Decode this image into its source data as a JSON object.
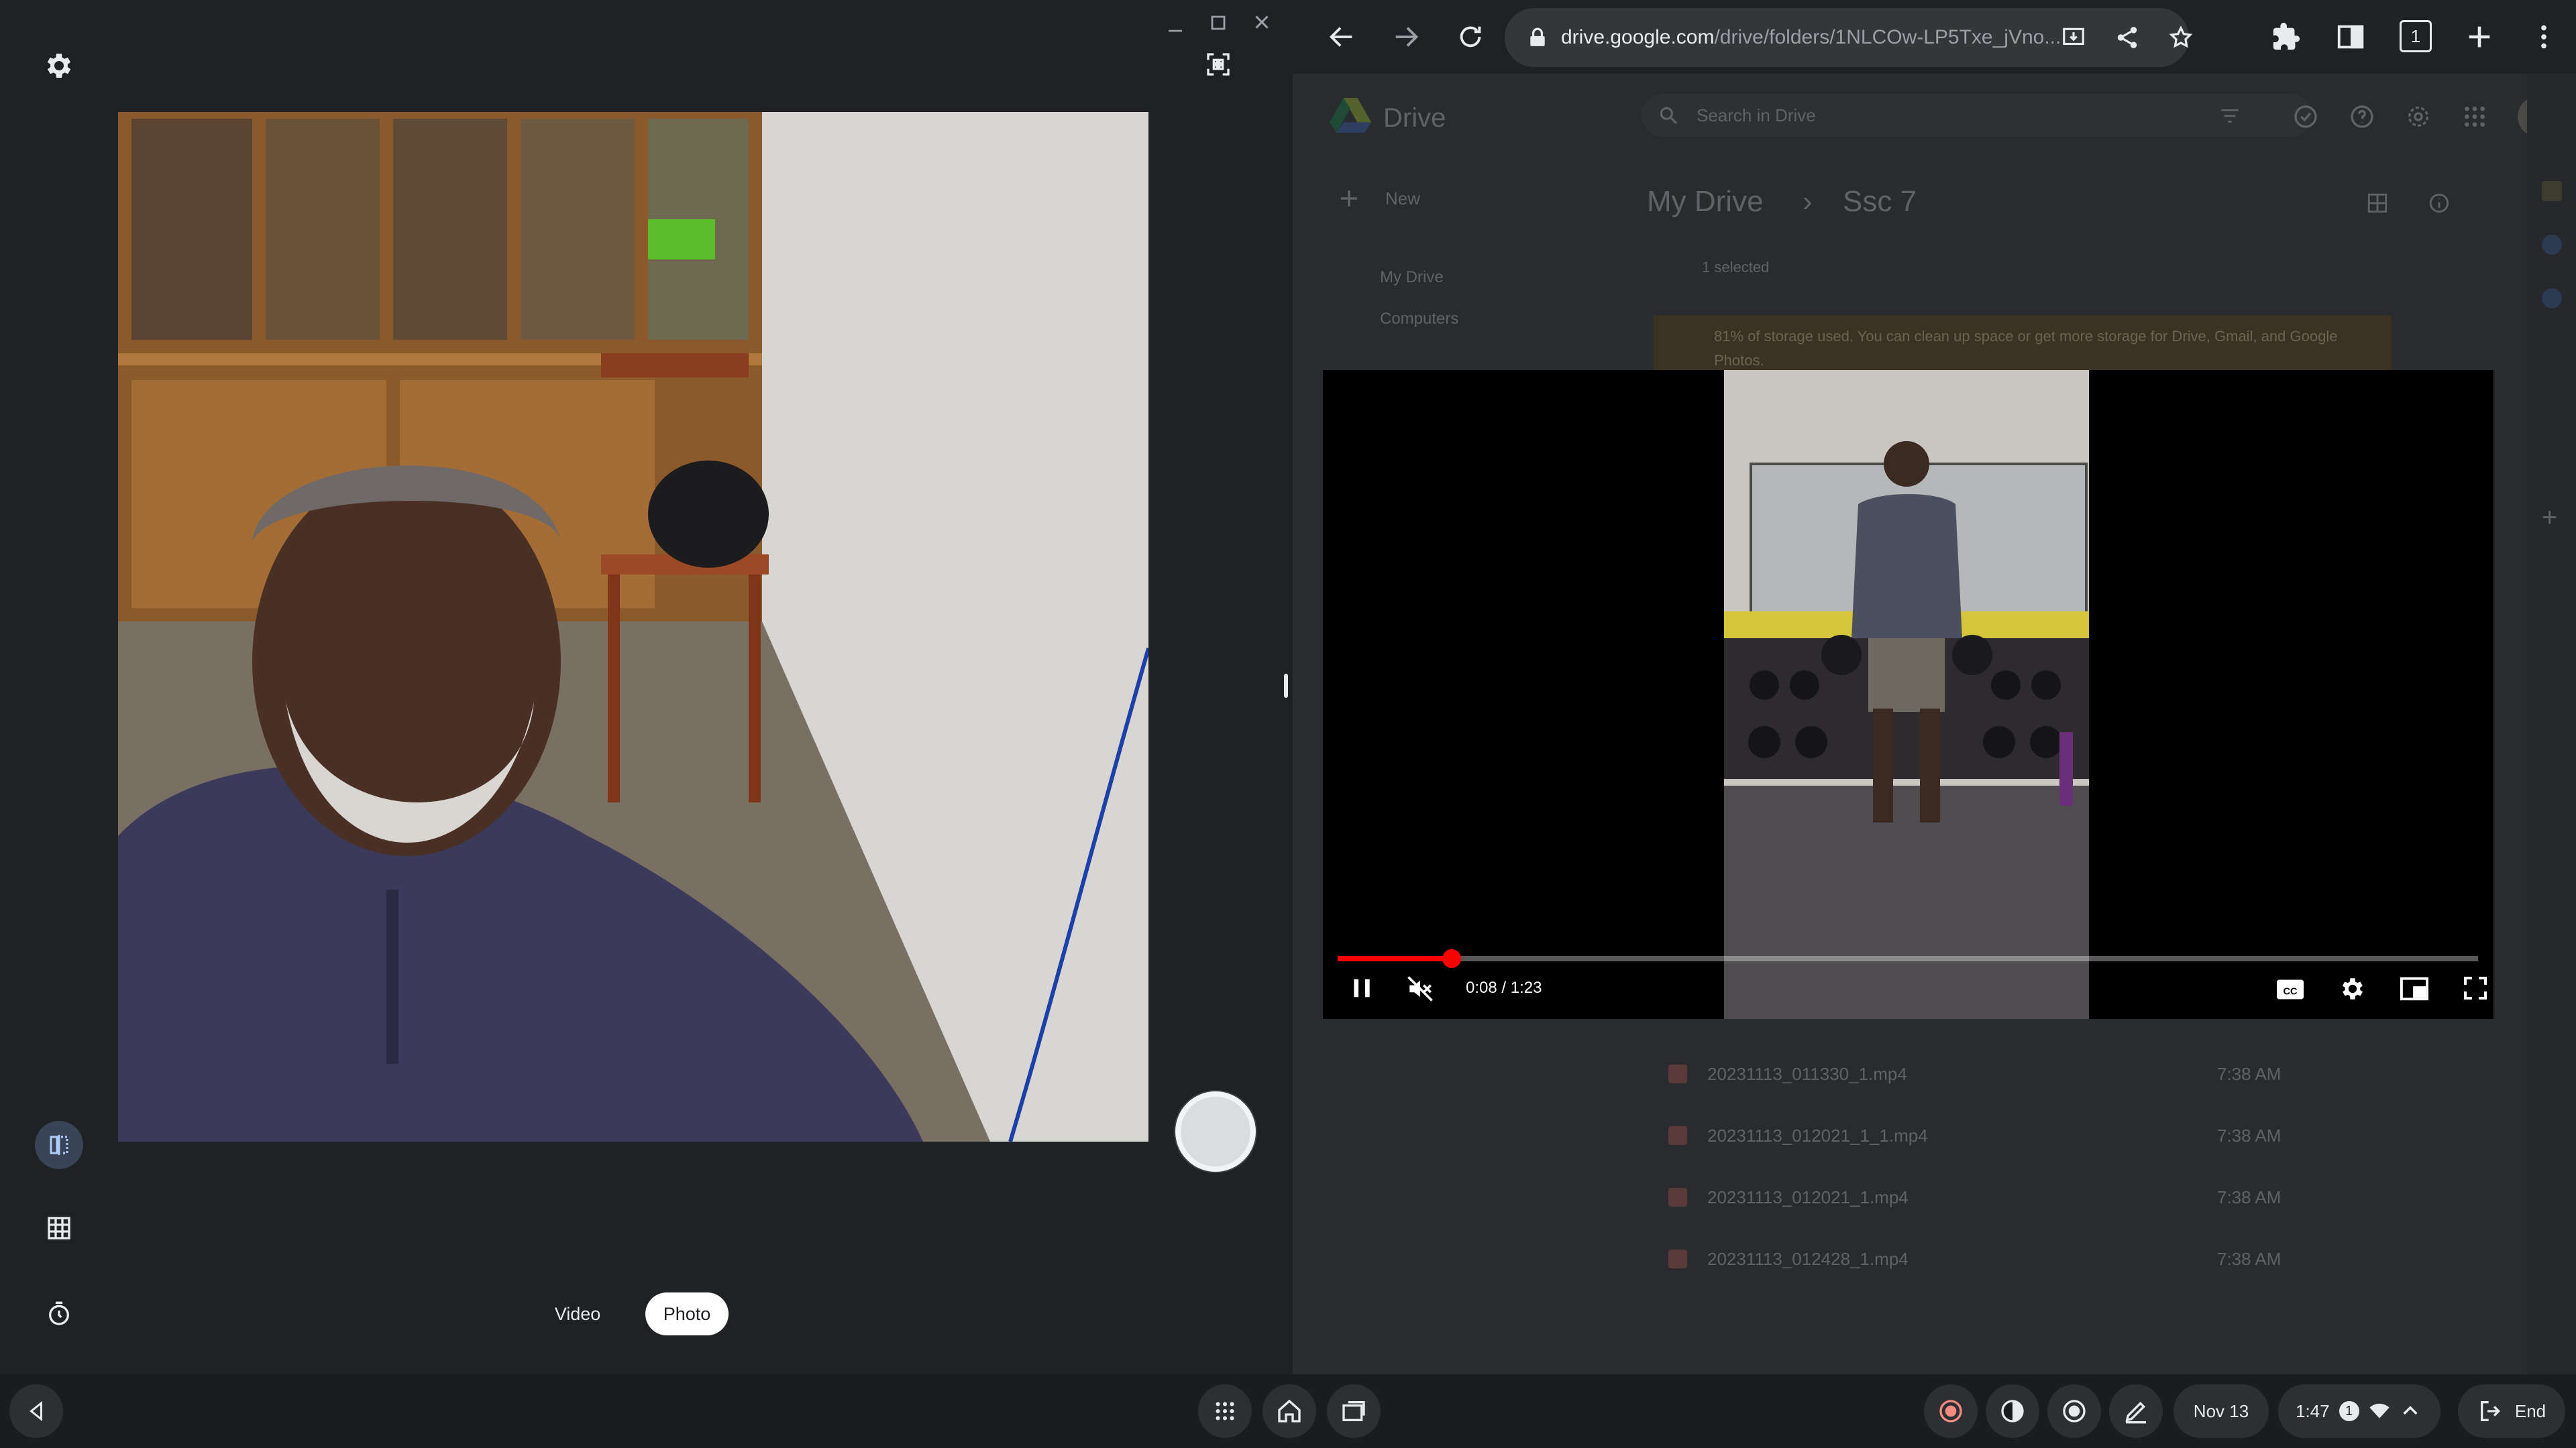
{
  "camera": {
    "modes": {
      "video": "Video",
      "photo": "Photo"
    },
    "selected_mode": "photo"
  },
  "browser": {
    "url_host": "drive.google.com",
    "url_path": "/drive/folders/1NLCOw-LP5Txe_jVno...",
    "tab_count": "1"
  },
  "drive": {
    "logo_text": "Drive",
    "search_placeholder": "Search in Drive",
    "new_button": "New",
    "nav": [
      "My Drive",
      "Computers"
    ],
    "breadcrumb": [
      "My Drive",
      "Ssc 7"
    ],
    "selection": "1 selected",
    "storage_banner": "81% of storage used. You can clean up space or get more storage for Drive, Gmail, and Google Photos.",
    "files": [
      {
        "name": "20231113_011330_1.mp4",
        "time": "7:38 AM"
      },
      {
        "name": "20231113_012021_1_1.mp4",
        "time": "7:38 AM"
      },
      {
        "name": "20231113_012021_1.mp4",
        "time": "7:38 AM"
      },
      {
        "name": "20231113_012428_1.mp4",
        "time": "7:38 AM"
      }
    ]
  },
  "video_player": {
    "time_display": "0:08 / 1:23",
    "progress": 0.1,
    "muted": true,
    "accent_color": "#ff0000"
  },
  "shelf": {
    "date": "Nov 13",
    "time": "1:47",
    "notification_count": "1",
    "end_label": "End"
  }
}
